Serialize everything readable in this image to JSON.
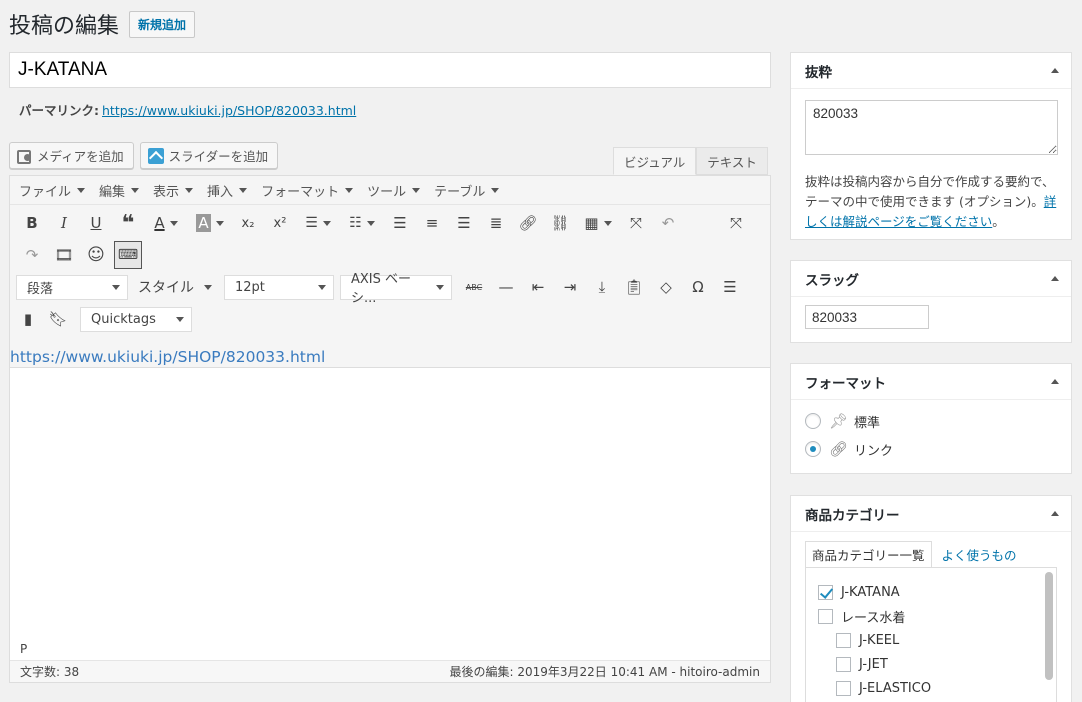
{
  "page": {
    "title": "投稿の編集",
    "add_new_label": "新規追加"
  },
  "post": {
    "title_value": "J-KATANA",
    "permalink_label": "パーマリンク:",
    "permalink_url": "https://www.ukiuki.jp/SHOP/820033.html"
  },
  "media_buttons": {
    "add_media": "メディアを追加",
    "add_slider": "スライダーを追加"
  },
  "editor_tabs": {
    "visual": "ビジュアル",
    "text": "テキスト"
  },
  "menubar": [
    "ファイル",
    "編集",
    "表示",
    "挿入",
    "フォーマット",
    "ツール",
    "テーブル"
  ],
  "toolbar": {
    "paragraph": "段落",
    "style": "スタイル",
    "font_size": "12pt",
    "font_family": "AXIS ベーシ...",
    "quicktags": "Quicktags"
  },
  "editor": {
    "content": "https://www.ukiuki.jp/SHOP/820033.html",
    "path": "P",
    "word_count": "文字数: 38",
    "last_edited": "最後の編集: 2019年3月22日 10:41 AM - hitoiro-admin"
  },
  "excerpt_box": {
    "title": "抜粋",
    "value": "820033",
    "help_text": "抜粋は投稿内容から自分で作成する要約で、テーマの中で使用できます (オプション)。",
    "help_link": "詳しくは解説ページをご覧ください",
    "help_tail": "。"
  },
  "slug_box": {
    "title": "スラッグ",
    "value": "820033"
  },
  "format_box": {
    "title": "フォーマット",
    "options": [
      {
        "label": "標準",
        "icon": "pin-icon",
        "selected": false
      },
      {
        "label": "リンク",
        "icon": "link-icon",
        "selected": true
      }
    ]
  },
  "category_box": {
    "title": "商品カテゴリー",
    "tab_all": "商品カテゴリー一覧",
    "tab_popular": "よく使うもの",
    "items": [
      {
        "label": "J-KATANA",
        "checked": true,
        "level": 0
      },
      {
        "label": "レース水着",
        "checked": false,
        "level": 0
      },
      {
        "label": "J-KEEL",
        "checked": false,
        "level": 1
      },
      {
        "label": "J-JET",
        "checked": false,
        "level": 1
      },
      {
        "label": "J-ELASTICO",
        "checked": false,
        "level": 1
      }
    ]
  },
  "colors": {
    "link": "#0073aa",
    "radio_active": "#1e8cbe"
  }
}
